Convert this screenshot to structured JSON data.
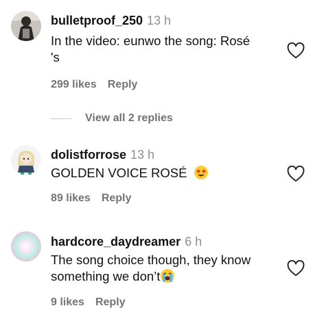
{
  "comments": [
    {
      "username": "bulletproof_250",
      "time": "13 h",
      "text_line1": "In the video: eunwo the song: Rosé",
      "text_line2": "'s",
      "likes": "299 likes",
      "reply": "Reply",
      "avatar_icon": "person-photo-avatar"
    },
    {
      "username": "dolistforrose",
      "time": "13 h",
      "text": "GOLDEN VOICE ROSÉ",
      "emoji": "star-struck-emoji",
      "likes": "89 likes",
      "reply": "Reply",
      "avatar_icon": "cartoon-doll-avatar"
    },
    {
      "username": "hardcore_daydreamer",
      "time": "6 h",
      "text_line1": "The song choice though, they know",
      "text_line2": "something we don’t",
      "emoji": "crying-emoji",
      "likes": "9 likes",
      "reply": "Reply",
      "avatar_icon": "pastel-gradient-avatar"
    }
  ],
  "view_replies": "View all 2 replies",
  "colors": {
    "secondary_text": "#737373",
    "heart_stroke": "#262626"
  }
}
